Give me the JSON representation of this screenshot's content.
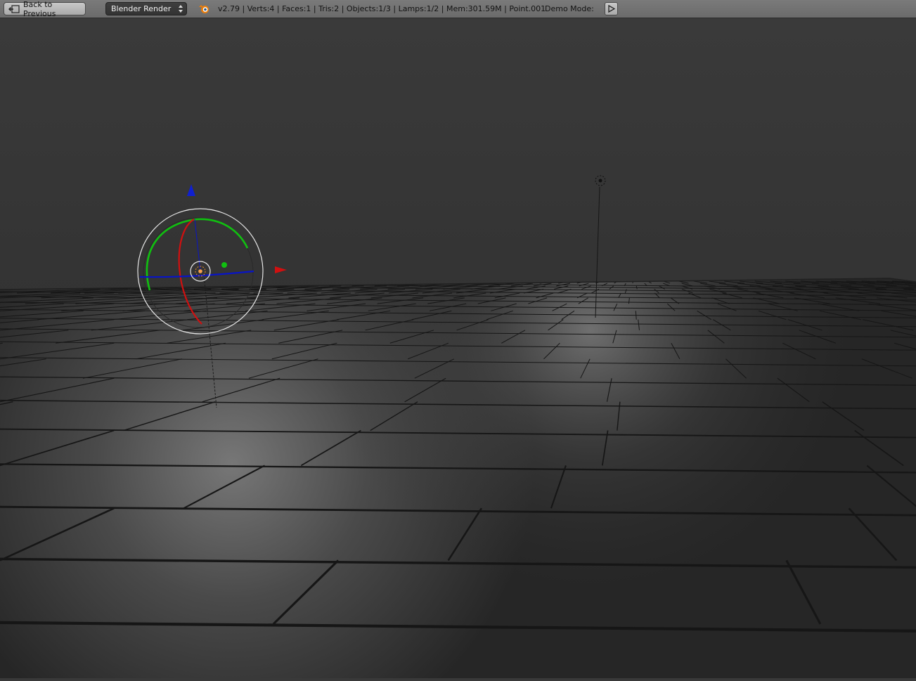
{
  "header": {
    "back_label": "Back to Previous",
    "render_engine": "Blender Render",
    "stats": "v2.79 | Verts:4 | Faces:1 | Tris:2 | Objects:1/3 | Lamps:1/2 | Mem:301.59M | Point.001",
    "demo_mode_label": "Demo Mode:"
  },
  "icons": {
    "back": "back-arrow-icon",
    "engine_arrows": "dropdown-arrows-icon",
    "logo": "blender-logo-icon",
    "play": "play-icon"
  },
  "colors": {
    "header_bg": "#6f6f6f",
    "viewport_bg": "#393939",
    "floor": "#2e2e2e",
    "axis_x": "#d40000",
    "axis_y": "#00b000",
    "axis_z": "#0010d0"
  }
}
